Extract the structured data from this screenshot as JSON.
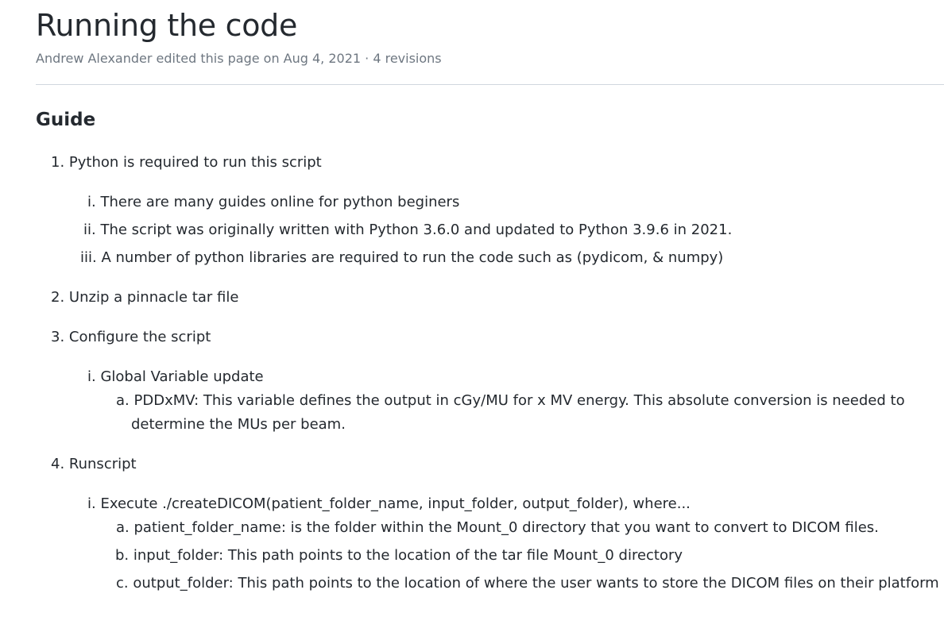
{
  "page": {
    "title": "Running the code",
    "meta": {
      "author": "Andrew Alexander",
      "action": " edited this page on Aug 4, 2021 · ",
      "revisions": "4 revisions"
    }
  },
  "section": {
    "heading": "Guide",
    "items": [
      {
        "marker": "1.",
        "text": "Python is required to run this script",
        "sub": [
          {
            "marker": "i.",
            "text": "There are many guides online for python beginers"
          },
          {
            "marker": "ii.",
            "text": "The script was originally written with Python 3.6.0 and updated to Python 3.9.6 in 2021."
          },
          {
            "marker": "iii.",
            "text": "A number of python libraries are required to run the code such as (pydicom, & numpy)"
          }
        ]
      },
      {
        "marker": "2.",
        "text": "Unzip a pinnacle tar file"
      },
      {
        "marker": "3.",
        "text": "Configure the script",
        "sub": [
          {
            "marker": "i.",
            "text": "Global Variable update",
            "sub": [
              {
                "marker": "a.",
                "text": "PDDxMV: This variable defines the output in cGy/MU for x MV energy. This absolute conversion is needed to",
                "cont": "determine the MUs per beam."
              }
            ]
          }
        ]
      },
      {
        "marker": "4.",
        "text": "Runscript",
        "sub": [
          {
            "marker": "i.",
            "text": "Execute ./createDICOM(patient_folder_name, input_folder, output_folder), where...",
            "sub": [
              {
                "marker": "a.",
                "text": "patient_folder_name: is the folder within the Mount_0 directory that you want to convert to DICOM files."
              },
              {
                "marker": "b.",
                "text": "input_folder: This path points to the location of the tar file Mount_0 directory"
              },
              {
                "marker": "c.",
                "text": "output_folder: This path points to the location of where the user wants to store the DICOM files on their platform"
              }
            ]
          }
        ]
      }
    ]
  }
}
